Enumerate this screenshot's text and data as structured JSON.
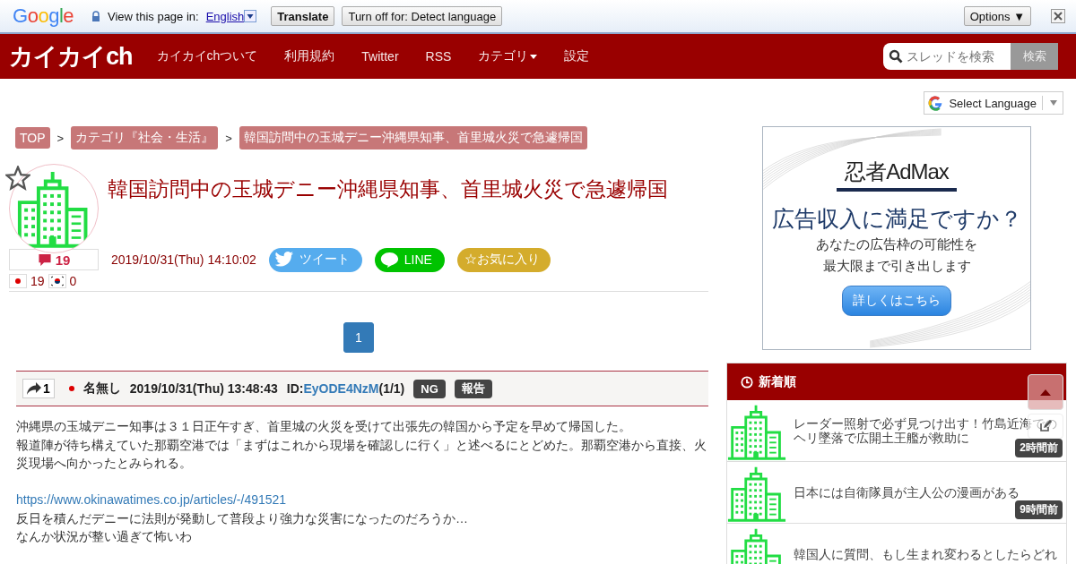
{
  "translate_bar": {
    "logo": "Google",
    "prompt": "View this page in:",
    "language": "English",
    "translate_button": "Translate",
    "turn_off_button": "Turn off for: Detect language",
    "options_button": "Options ▼"
  },
  "nav": {
    "logo": "カイカイch",
    "items": [
      {
        "label": "カイカイchついて",
        "kind": "link"
      },
      {
        "label": "利用規約",
        "kind": "link"
      },
      {
        "label": "Twitter",
        "kind": "link"
      },
      {
        "label": "RSS",
        "kind": "link"
      },
      {
        "label": "カテゴリ",
        "kind": "dropdown"
      },
      {
        "label": "設定",
        "kind": "link"
      }
    ],
    "search": {
      "placeholder": "スレッドを検索",
      "button": "検索"
    }
  },
  "language_select": {
    "label": "Select Language"
  },
  "breadcrumbs": [
    {
      "label": "TOP"
    },
    {
      "separator": ">",
      "label": "カテゴリ『社会・生活』"
    },
    {
      "separator": ">",
      "label": "韓国訪問中の玉城デニー沖縄県知事、首里城火災で急遽帰国"
    }
  ],
  "thread": {
    "title": "韓国訪問中の玉城デニー沖縄県知事、首里城火災で急遽帰国",
    "comment_count": "19",
    "date": "2019/10/31(Thu) 14:10:02",
    "share_buttons": [
      {
        "label": "ツイート",
        "kind": "twitter"
      },
      {
        "label": "LINE",
        "kind": "line"
      },
      {
        "label": "☆お気に入り",
        "kind": "favorite"
      }
    ],
    "country_counts": [
      {
        "kind": "japan",
        "count": "19"
      },
      {
        "kind": "korea",
        "count": "0"
      }
    ]
  },
  "pagination": [
    {
      "label": "1",
      "selected": true
    }
  ],
  "post": {
    "reply": "1",
    "name": "名無し",
    "date": "2019/10/31(Thu) 13:48:43",
    "id_label": "ID:",
    "id": "EyODE4NzM",
    "id_count": "(1/1)",
    "buttons": [
      "NG",
      "報告"
    ],
    "body": [
      {
        "kind": "text",
        "text": "沖縄県の玉城デニー知事は３１日正午すぎ、首里城の火災を受けて出張先の韓国から予定を早めて帰国した。"
      },
      {
        "kind": "text",
        "text": "報道陣が待ち構えていた那覇空港では「まずはこれから現場を確認しに行く」と述べるにとどめた。那覇空港から直接、火災現場へ向かったとみられる。"
      },
      {
        "kind": "blank"
      },
      {
        "kind": "link",
        "text": "https://www.okinawatimes.co.jp/articles/-/491521"
      },
      {
        "kind": "text",
        "text": "反日を積んだデニーに法則が発動して普段より強力な災害になったのだろうか…"
      },
      {
        "kind": "text",
        "text": "なんか状況が整い過ぎて怖いわ"
      }
    ]
  },
  "ad": {
    "brand": "忍者AdMax",
    "headline": "広告収入に満足ですか？",
    "lines": [
      "あなたの広告枠の可能性を",
      "最大限まで引き出します"
    ],
    "button": "詳しくはこちら"
  },
  "sidebar": {
    "title": "新着順",
    "items": [
      {
        "title": "レーダー照射で必ず見つけ出す！竹島近海でのヘリ墜落で広開土王艦が救助に",
        "time": "2時間前"
      },
      {
        "title": "日本には自衛隊員が主人公の漫画がある",
        "time": "9時間前"
      },
      {
        "title": "韓国人に質問、もし生まれ変わるとしたらどれ"
      }
    ]
  }
}
